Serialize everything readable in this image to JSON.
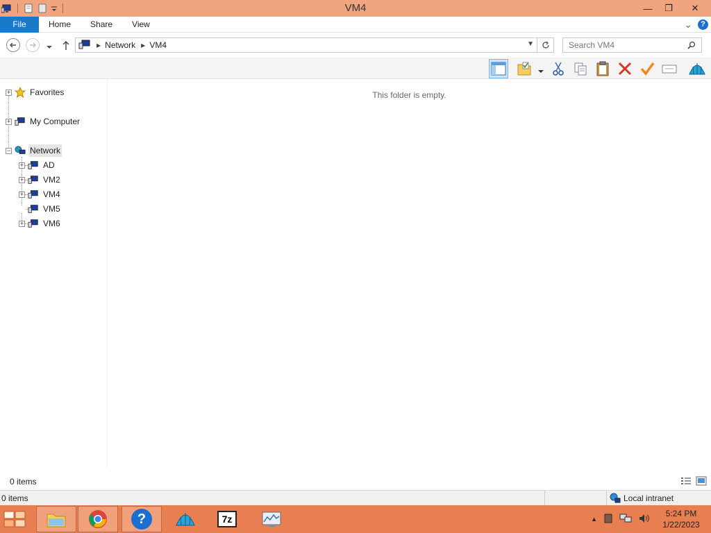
{
  "window": {
    "title": "VM4",
    "minimize": "—",
    "maximize": "❐",
    "close": "✕"
  },
  "ribbon": {
    "tabs": [
      "File",
      "Home",
      "Share",
      "View"
    ],
    "expand": "⌄",
    "help": "?"
  },
  "address": {
    "crumbs": [
      "Network",
      "VM4"
    ],
    "search_placeholder": "Search VM4"
  },
  "tree": {
    "favorites": "Favorites",
    "my_computer": "My Computer",
    "network": "Network",
    "children": [
      "AD",
      "VM2",
      "VM4",
      "VM5",
      "VM6"
    ]
  },
  "content": {
    "empty_message": "This folder is empty."
  },
  "status": {
    "items": "0 items",
    "bottom_items": "0 items",
    "zone": "Local intranet"
  },
  "taskbar": {
    "time": "5:24 PM",
    "date": "1/22/2023",
    "sevenzip_label": "7z",
    "help_label": "?"
  },
  "colors": {
    "titlebar": "#f0a580",
    "file_tab": "#1979ca",
    "taskbar": "#e87f50"
  }
}
